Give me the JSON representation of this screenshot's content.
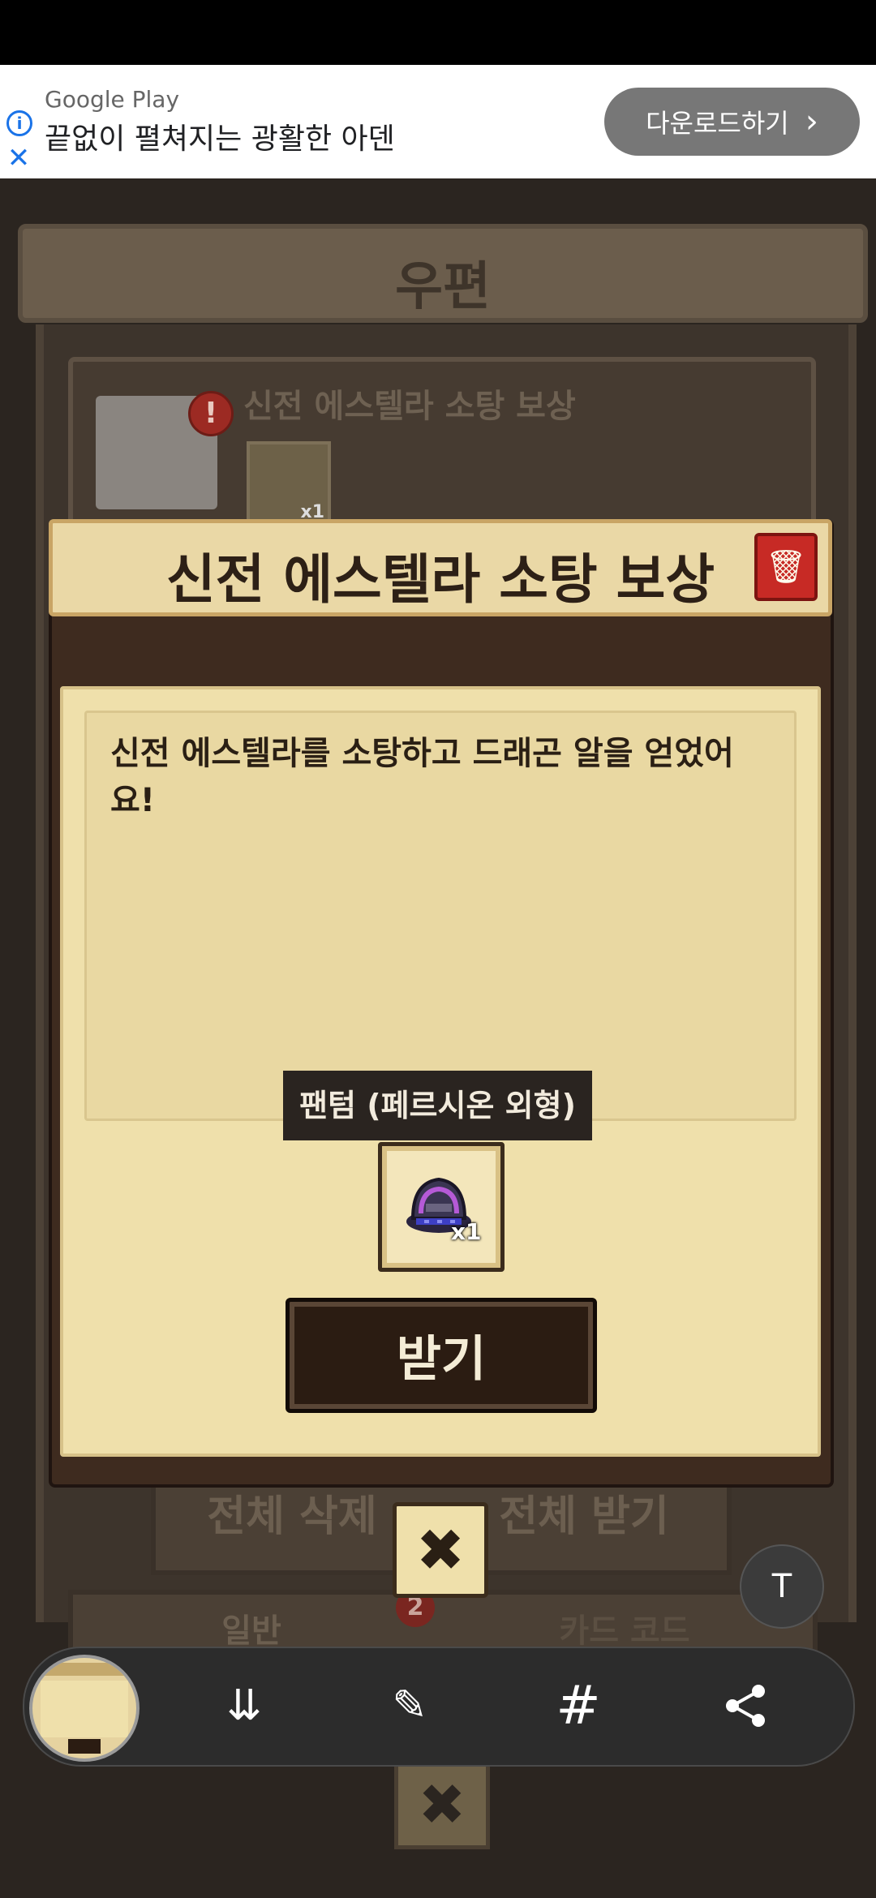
{
  "ad": {
    "source": "Google Play",
    "headline": "끝없이 펼쳐지는 광활한 아덴",
    "cta_label": "다운로드하기",
    "cta_chevron": "›",
    "info_icon_glyph": "i",
    "close_icon_glyph": "✕"
  },
  "background": {
    "screen_title": "우편",
    "mail_item_title": "신전 에스텔라 소탕 보상",
    "mail_item_qty": "x1",
    "delete_all_label": "전체 삭제",
    "receive_all_label": "전체 받기",
    "tabs": [
      {
        "label": "일반"
      },
      {
        "label": "카드 코드"
      }
    ],
    "general_tab_badge": "2",
    "alert_glyph": "!"
  },
  "dialog": {
    "title": "신전 에스텔라 소탕 보상",
    "message": "신전 에스텔라를 소탕하고 드래곤 알을 얻었어요!",
    "reward_tooltip": "팬텀 (페르시온 외형)",
    "reward_quantity": "x1",
    "receive_label": "받기",
    "close_glyph": "✖",
    "trash_glyph": "🗑"
  },
  "overlay": {
    "text_extract_glyph": "T",
    "tools": [
      {
        "name": "scroll-capture",
        "glyph": "⇊"
      },
      {
        "name": "draw",
        "glyph": "✎"
      },
      {
        "name": "hashtag",
        "glyph": "#"
      },
      {
        "name": "share",
        "glyph": "⋖"
      }
    ]
  },
  "colors": {
    "dialog_bg": "#efe0ab",
    "title_bar": "#ead8a6",
    "trash_red": "#c72a25",
    "receive_button": "#2b1c12",
    "ad_button": "#777777",
    "link_blue": "#1a73e8"
  }
}
